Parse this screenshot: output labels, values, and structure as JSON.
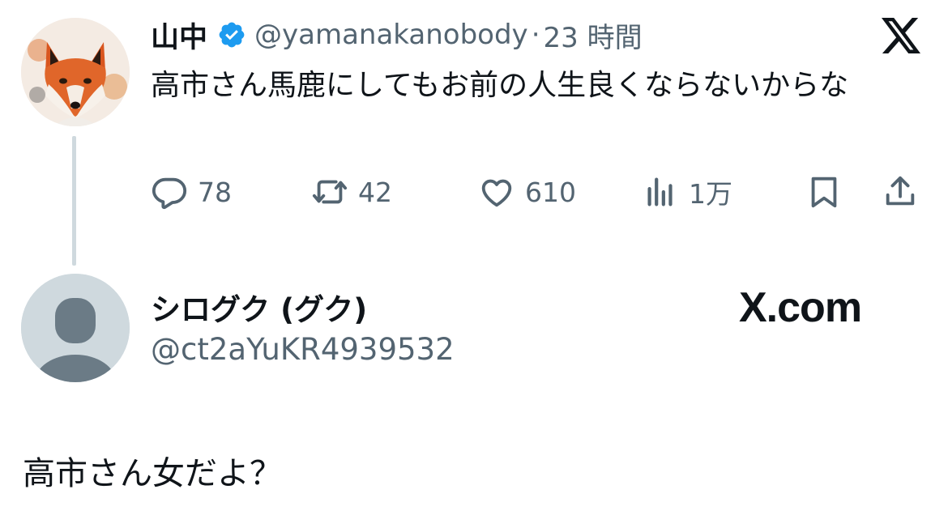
{
  "tweet": {
    "author_name": "山中",
    "handle": "@yamanakanobody",
    "separator": "·",
    "time": "23 時間",
    "text": "高市さん馬鹿にしてもお前の人生良くならないからな",
    "stats": {
      "replies": "78",
      "retweets": "42",
      "likes": "610",
      "views": "1万"
    }
  },
  "reply_author": {
    "name": "シログク (グク)",
    "handle": "@ct2aYuKR4939532"
  },
  "watermark": "X.com",
  "reply_text": "高市さん女だよ？",
  "colors": {
    "text": "#0f1419",
    "muted": "#536471",
    "verified": "#1d9bf0",
    "thread_line": "#cfd9de"
  },
  "icons": [
    "x-logo-icon",
    "verified-badge-icon",
    "reply-icon",
    "retweet-icon",
    "like-icon",
    "views-icon",
    "bookmark-icon",
    "share-icon"
  ]
}
